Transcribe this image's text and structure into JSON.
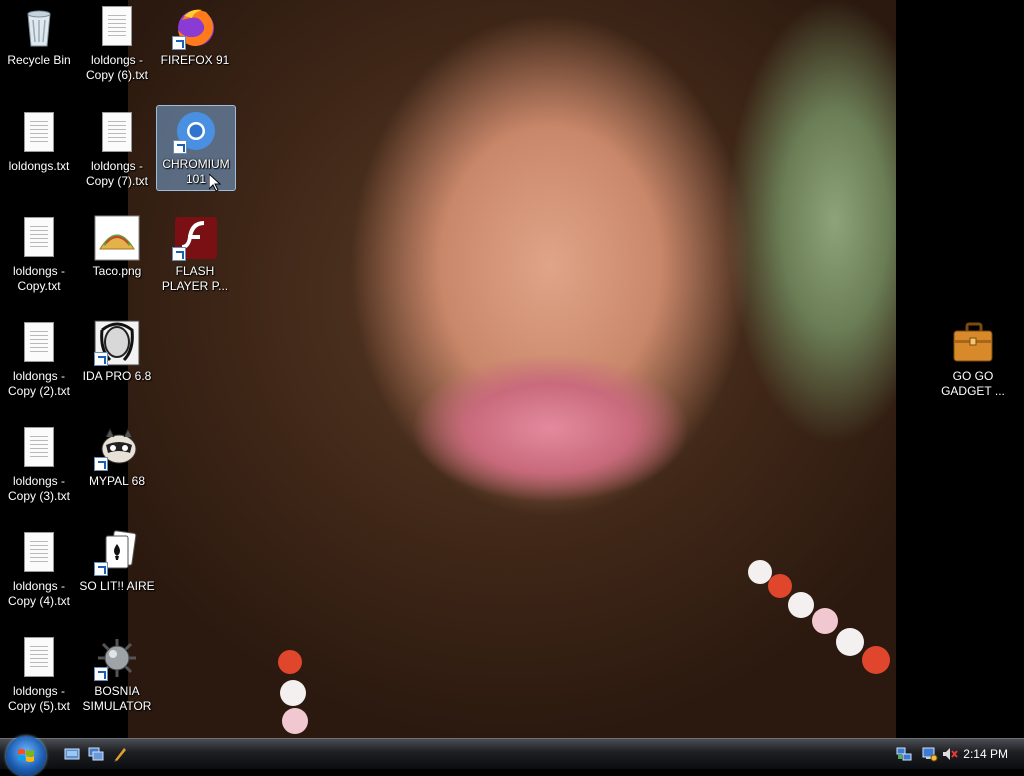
{
  "desktop": {
    "icons": {
      "recycle_bin": "Recycle Bin",
      "loldongs_copy6": "loldongs - Copy (6).txt",
      "firefox": "FIREFOX 91",
      "loldongs": "loldongs.txt",
      "loldongs_copy7": "loldongs - Copy (7).txt",
      "chromium": "CHROMIUM 101",
      "loldongs_copy": "loldongs - Copy.txt",
      "taco": "Taco.png",
      "flash": "FLASH PLAYER P...",
      "loldongs_copy2": "loldongs - Copy (2).txt",
      "ida": "IDA PRO 6.8",
      "loldongs_copy3": "loldongs - Copy (3).txt",
      "mypal": "MYPAL 68",
      "loldongs_copy4": "loldongs - Copy (4).txt",
      "solitaire": "SO LIT!! AIRE",
      "loldongs_copy5": "loldongs - Copy (5).txt",
      "bosnia": "BOSNIA SIMULATOR",
      "gadget": "GO GO GADGET ..."
    },
    "selected_icon": "chromium"
  },
  "taskbar": {
    "clock": "2:14 PM",
    "quick_launch": [
      "show-desktop-icon",
      "switch-windows-icon",
      "taskbar-program-icon"
    ],
    "tray": [
      "network-icon",
      "monitor-icon",
      "volume-muted-icon"
    ]
  },
  "colors": {
    "taskbar_top": "#4a4d52",
    "taskbar_bottom": "#0c0d10",
    "selection": "#78aadc",
    "start_orb": "#1d5fb4"
  }
}
